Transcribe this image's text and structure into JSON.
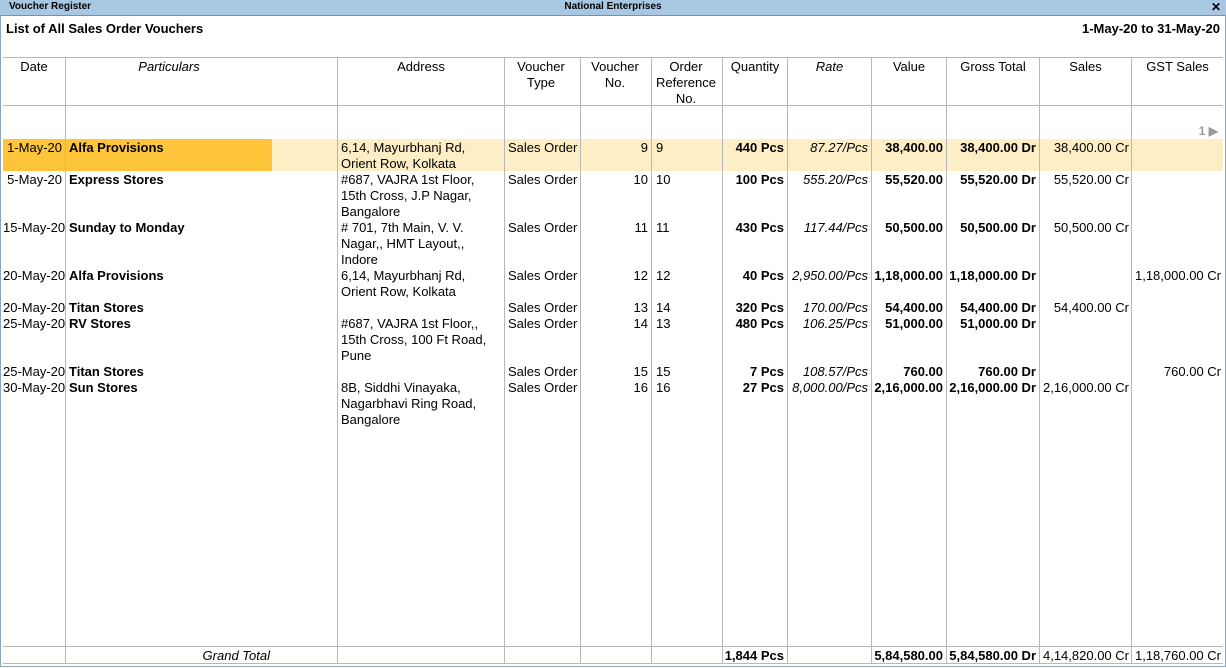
{
  "window": {
    "title_left": "Voucher Register",
    "title_center": "National Enterprises",
    "close": "✕"
  },
  "report": {
    "title": "List of All Sales Order Vouchers",
    "period": "1-May-20 to 31-May-20",
    "page": "1 ▶"
  },
  "columns": {
    "date": "Date",
    "particulars": "Particulars",
    "address": "Address",
    "voucher_type": "Voucher Type",
    "voucher_no": "Voucher No.",
    "order_ref": "Order Reference No.",
    "quantity": "Quantity",
    "rate": "Rate",
    "value": "Value",
    "gross_total": "Gross Total",
    "sales": "Sales",
    "gst_sales": "GST Sales"
  },
  "rows": [
    {
      "date": "1-May-20",
      "particulars": "Alfa Provisions",
      "address": [
        "6,14, Mayurbhanj Rd,",
        "Orient Row, Kolkata"
      ],
      "voucher_type": "Sales Order",
      "voucher_no": "9",
      "order_ref": "9",
      "quantity": "440 Pcs",
      "rate": "87.27/Pcs",
      "value": "38,400.00",
      "gross_total": "38,400.00 Dr",
      "sales": "38,400.00 Cr",
      "gst_sales": ""
    },
    {
      "date": "5-May-20",
      "particulars": "Express Stores",
      "address": [
        "#687, VAJRA 1st Floor,",
        "15th Cross, J.P Nagar,",
        "Bangalore"
      ],
      "voucher_type": "Sales Order",
      "voucher_no": "10",
      "order_ref": "10",
      "quantity": "100 Pcs",
      "rate": "555.20/Pcs",
      "value": "55,520.00",
      "gross_total": "55,520.00 Dr",
      "sales": "55,520.00 Cr",
      "gst_sales": ""
    },
    {
      "date": "15-May-20",
      "particulars": "Sunday to Monday",
      "address": [
        "# 701, 7th Main, V. V.",
        "Nagar,, HMT Layout,,",
        "Indore"
      ],
      "voucher_type": "Sales Order",
      "voucher_no": "11",
      "order_ref": "11",
      "quantity": "430 Pcs",
      "rate": "117.44/Pcs",
      "value": "50,500.00",
      "gross_total": "50,500.00 Dr",
      "sales": "50,500.00 Cr",
      "gst_sales": ""
    },
    {
      "date": "20-May-20",
      "particulars": "Alfa Provisions",
      "address": [
        "6,14, Mayurbhanj Rd,",
        "Orient Row, Kolkata"
      ],
      "voucher_type": "Sales Order",
      "voucher_no": "12",
      "order_ref": "12",
      "quantity": "40 Pcs",
      "rate": "2,950.00/Pcs",
      "value": "1,18,000.00",
      "gross_total": "1,18,000.00 Dr",
      "sales": "",
      "gst_sales": "1,18,000.00 Cr"
    },
    {
      "date": "20-May-20",
      "particulars": "Titan Stores",
      "address": [],
      "voucher_type": "Sales Order",
      "voucher_no": "13",
      "order_ref": "14",
      "quantity": "320 Pcs",
      "rate": "170.00/Pcs",
      "value": "54,400.00",
      "gross_total": "54,400.00 Dr",
      "sales": "54,400.00 Cr",
      "gst_sales": ""
    },
    {
      "date": "25-May-20",
      "particulars": "RV Stores",
      "address": [
        "#687, VAJRA 1st Floor,,",
        "15th Cross, 100 Ft Road,",
        "Pune"
      ],
      "voucher_type": "Sales Order",
      "voucher_no": "14",
      "order_ref": "13",
      "quantity": "480 Pcs",
      "rate": "106.25/Pcs",
      "value": "51,000.00",
      "gross_total": "51,000.00 Dr",
      "sales": "",
      "gst_sales": ""
    },
    {
      "date": "25-May-20",
      "particulars": "Titan Stores",
      "address": [],
      "voucher_type": "Sales Order",
      "voucher_no": "15",
      "order_ref": "15",
      "quantity": "7 Pcs",
      "rate": "108.57/Pcs",
      "value": "760.00",
      "gross_total": "760.00 Dr",
      "sales": "",
      "gst_sales": "760.00 Cr"
    },
    {
      "date": "30-May-20",
      "particulars": "Sun Stores",
      "address": [
        "8B, Siddhi Vinayaka,",
        "Nagarbhavi Ring Road,",
        "Bangalore"
      ],
      "voucher_type": "Sales Order",
      "voucher_no": "16",
      "order_ref": "16",
      "quantity": "27 Pcs",
      "rate": "8,000.00/Pcs",
      "value": "2,16,000.00",
      "gross_total": "2,16,000.00 Dr",
      "sales": "2,16,000.00 Cr",
      "gst_sales": ""
    }
  ],
  "totals": {
    "label": "Grand Total",
    "quantity": "1,844 Pcs",
    "value": "5,84,580.00",
    "gross_total": "5,84,580.00 Dr",
    "sales": "4,14,820.00 Cr",
    "gst_sales": "1,18,760.00 Cr"
  }
}
